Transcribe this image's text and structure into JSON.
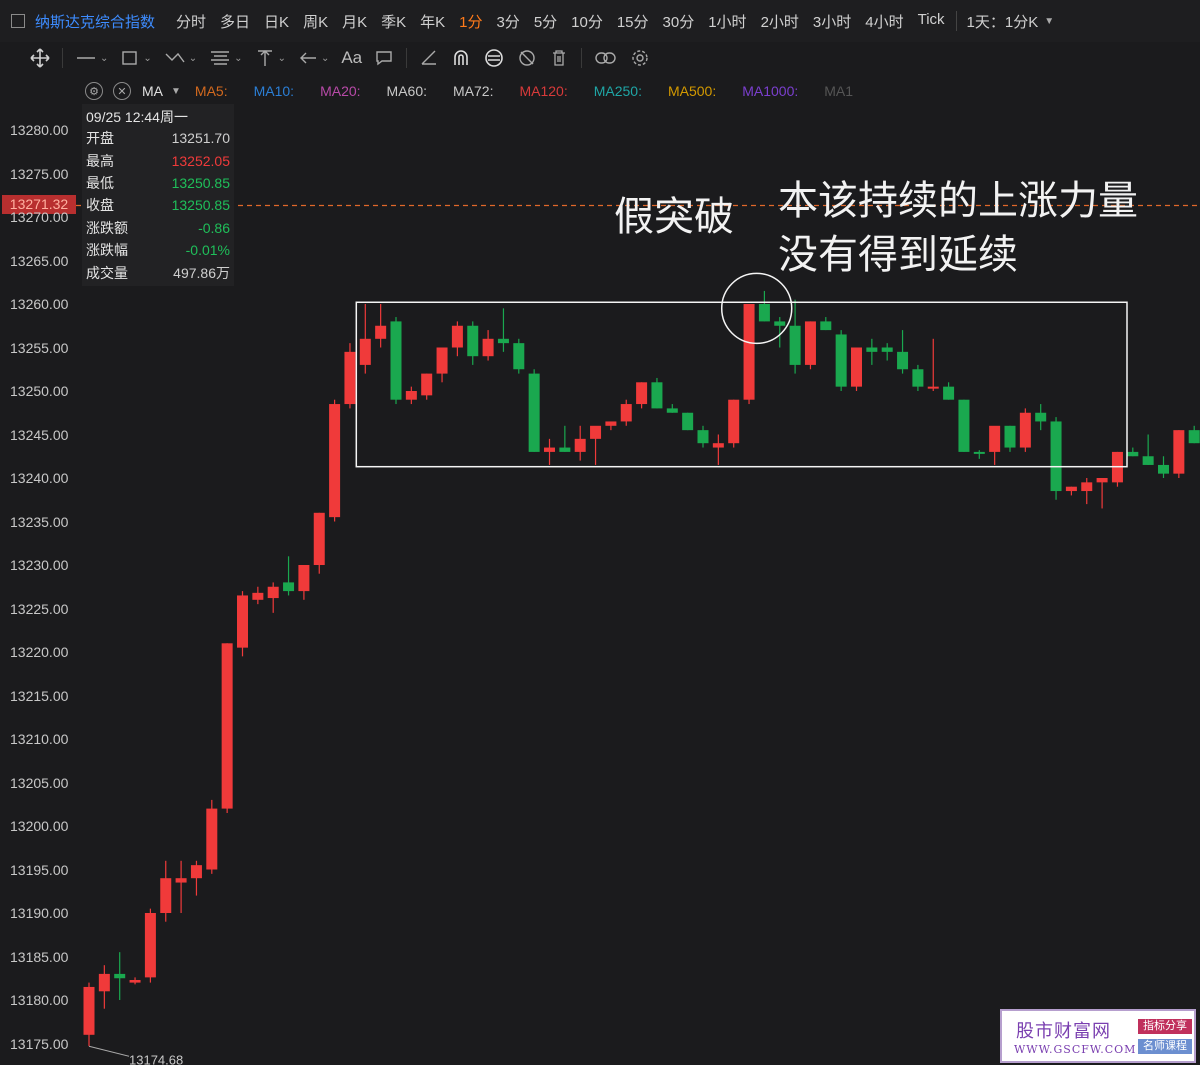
{
  "topbar": {
    "instrument": "纳斯达克综合指数",
    "timeframes": [
      "分时",
      "多日",
      "日K",
      "周K",
      "月K",
      "季K",
      "年K",
      "1分",
      "3分",
      "5分",
      "10分",
      "15分",
      "30分",
      "1小时",
      "2小时",
      "3小时",
      "4小时",
      "Tick"
    ],
    "active_timeframe": "1分",
    "range_label": "1天：1分K"
  },
  "toolbar": {
    "icons": [
      "crosshair-icon",
      "line-icon",
      "rectangle-icon",
      "polyline-icon",
      "fib-icon",
      "vertical-line-icon",
      "arrow-icon",
      "text-icon",
      "comment-icon",
      "ruler-icon",
      "magnet-icon",
      "sync-icon",
      "hide-icon",
      "delete-icon",
      "link-icon",
      "settings-icon"
    ]
  },
  "ma_row": {
    "label": "MA",
    "items": [
      {
        "text": "MA5:",
        "color": "#d2691e"
      },
      {
        "text": "MA10:",
        "color": "#2b7fd6"
      },
      {
        "text": "MA20:",
        "color": "#b84aa8"
      },
      {
        "text": "MA60:",
        "color": "#c8c8c8"
      },
      {
        "text": "MA72:",
        "color": "#c8c8c8"
      },
      {
        "text": "MA120:",
        "color": "#d83a3a"
      },
      {
        "text": "MA250:",
        "color": "#1fa6a6"
      },
      {
        "text": "MA500:",
        "color": "#d49a00"
      },
      {
        "text": "MA1000:",
        "color": "#7b3fcf"
      },
      {
        "text": "MA1",
        "color": "#555555"
      }
    ]
  },
  "info_panel": {
    "datetime": "09/25 12:44周一",
    "rows": [
      {
        "key": "开盘",
        "value": "13251.70",
        "color": "#cfcfcf"
      },
      {
        "key": "最高",
        "value": "13252.05",
        "color": "#f03a3a"
      },
      {
        "key": "最低",
        "value": "13250.85",
        "color": "#1fbf5a"
      },
      {
        "key": "收盘",
        "value": "13250.85",
        "color": "#1fbf5a"
      },
      {
        "key": "涨跌额",
        "value": "-0.86",
        "color": "#1fbf5a"
      },
      {
        "key": "涨跌幅",
        "value": "-0.01%",
        "color": "#1fbf5a"
      },
      {
        "key": "成交量",
        "value": "497.86万",
        "color": "#cfcfcf"
      }
    ]
  },
  "current_price": {
    "value": "13271.32",
    "level": 13271.32
  },
  "annotations": {
    "fake_breakout": "假突破",
    "comment_line1": "本该持续的上涨力量",
    "comment_line2": "没有得到延续"
  },
  "watermark": {
    "name": "股市财富网",
    "url": "WWW.GSCFW.COM",
    "badge1": "指标分享",
    "badge2": "名师课程"
  },
  "chart_data": {
    "type": "candlestick",
    "y_ticks": [
      "13280.00",
      "13275.00",
      "13270.00",
      "13265.00",
      "13260.00",
      "13255.00",
      "13250.00",
      "13245.00",
      "13240.00",
      "13235.00",
      "13230.00",
      "13225.00",
      "13220.00",
      "13215.00",
      "13210.00",
      "13205.00",
      "13200.00",
      "13195.00",
      "13190.00",
      "13185.00",
      "13180.00",
      "13175.00"
    ],
    "ylim": [
      13175,
      13280
    ],
    "low_marker": "13174.68",
    "consolidation_box": {
      "price_high": 13260.2,
      "price_low": 13241.3
    },
    "breakout_circle": {
      "price": 13259.5
    },
    "candles": [
      {
        "o": 13176,
        "h": 13182,
        "l": 13174.7,
        "c": 13181.5
      },
      {
        "o": 13181,
        "h": 13184,
        "l": 13179,
        "c": 13183
      },
      {
        "o": 13183,
        "h": 13185.5,
        "l": 13180,
        "c": 13182.5
      },
      {
        "o": 13182,
        "h": 13182.6,
        "l": 13181.8,
        "c": 13182.3
      },
      {
        "o": 13182.6,
        "h": 13190.5,
        "l": 13182,
        "c": 13190
      },
      {
        "o": 13190,
        "h": 13196,
        "l": 13189,
        "c": 13194
      },
      {
        "o": 13193.5,
        "h": 13196,
        "l": 13190,
        "c": 13194
      },
      {
        "o": 13194,
        "h": 13196,
        "l": 13192,
        "c": 13195.5
      },
      {
        "o": 13195,
        "h": 13203,
        "l": 13194.5,
        "c": 13202
      },
      {
        "o": 13202,
        "h": 13221,
        "l": 13201.5,
        "c": 13221
      },
      {
        "o": 13220.5,
        "h": 13227,
        "l": 13219.5,
        "c": 13226.5
      },
      {
        "o": 13226,
        "h": 13227.5,
        "l": 13225.5,
        "c": 13226.8
      },
      {
        "o": 13226.2,
        "h": 13228,
        "l": 13224.5,
        "c": 13227.5
      },
      {
        "o": 13228,
        "h": 13231,
        "l": 13226.5,
        "c": 13227
      },
      {
        "o": 13227,
        "h": 13229,
        "l": 13226,
        "c": 13230
      },
      {
        "o": 13230,
        "h": 13236,
        "l": 13229,
        "c": 13236
      },
      {
        "o": 13235.5,
        "h": 13249,
        "l": 13235,
        "c": 13248.5
      },
      {
        "o": 13248.5,
        "h": 13255.5,
        "l": 13248,
        "c": 13254.5
      },
      {
        "o": 13253,
        "h": 13260,
        "l": 13252,
        "c": 13256
      },
      {
        "o": 13256,
        "h": 13260,
        "l": 13255,
        "c": 13257.5
      },
      {
        "o": 13258,
        "h": 13258.5,
        "l": 13248.5,
        "c": 13249
      },
      {
        "o": 13249,
        "h": 13250.5,
        "l": 13248.5,
        "c": 13250
      },
      {
        "o": 13249.5,
        "h": 13252,
        "l": 13249,
        "c": 13252
      },
      {
        "o": 13252,
        "h": 13255,
        "l": 13251,
        "c": 13255
      },
      {
        "o": 13255,
        "h": 13258,
        "l": 13254,
        "c": 13257.5
      },
      {
        "o": 13257.5,
        "h": 13258,
        "l": 13253,
        "c": 13254
      },
      {
        "o": 13254,
        "h": 13257,
        "l": 13253.5,
        "c": 13256
      },
      {
        "o": 13256,
        "h": 13259.5,
        "l": 13254.5,
        "c": 13255.5
      },
      {
        "o": 13255.5,
        "h": 13256,
        "l": 13252,
        "c": 13252.5
      },
      {
        "o": 13252,
        "h": 13252.5,
        "l": 13243,
        "c": 13243
      },
      {
        "o": 13243,
        "h": 13244.5,
        "l": 13241.5,
        "c": 13243.5
      },
      {
        "o": 13243.5,
        "h": 13246,
        "l": 13243,
        "c": 13243
      },
      {
        "o": 13243,
        "h": 13246,
        "l": 13242,
        "c": 13244.5
      },
      {
        "o": 13244.5,
        "h": 13245,
        "l": 13241.5,
        "c": 13246
      },
      {
        "o": 13246,
        "h": 13246.3,
        "l": 13245.5,
        "c": 13246.5
      },
      {
        "o": 13246.5,
        "h": 13249,
        "l": 13246,
        "c": 13248.5
      },
      {
        "o": 13248.5,
        "h": 13251,
        "l": 13248,
        "c": 13251
      },
      {
        "o": 13251,
        "h": 13251.5,
        "l": 13248,
        "c": 13248
      },
      {
        "o": 13248,
        "h": 13248.5,
        "l": 13247.5,
        "c": 13247.5
      },
      {
        "o": 13247.5,
        "h": 13247.5,
        "l": 13245.5,
        "c": 13245.5
      },
      {
        "o": 13245.5,
        "h": 13246,
        "l": 13243.5,
        "c": 13244
      },
      {
        "o": 13243.5,
        "h": 13245,
        "l": 13241.5,
        "c": 13244
      },
      {
        "o": 13244,
        "h": 13249,
        "l": 13243.5,
        "c": 13249
      },
      {
        "o": 13249,
        "h": 13260,
        "l": 13248.5,
        "c": 13260
      },
      {
        "o": 13260,
        "h": 13261.5,
        "l": 13258,
        "c": 13258
      },
      {
        "o": 13258,
        "h": 13258.5,
        "l": 13255,
        "c": 13257.5
      },
      {
        "o": 13257.5,
        "h": 13260.5,
        "l": 13252,
        "c": 13253
      },
      {
        "o": 13253,
        "h": 13258,
        "l": 13252.5,
        "c": 13258
      },
      {
        "o": 13258,
        "h": 13258.5,
        "l": 13257,
        "c": 13257
      },
      {
        "o": 13256.5,
        "h": 13257,
        "l": 13250,
        "c": 13250.5
      },
      {
        "o": 13250.5,
        "h": 13255,
        "l": 13250,
        "c": 13255
      },
      {
        "o": 13255,
        "h": 13256,
        "l": 13253,
        "c": 13254.5
      },
      {
        "o": 13255,
        "h": 13255.5,
        "l": 13253.5,
        "c": 13254.5
      },
      {
        "o": 13254.5,
        "h": 13257,
        "l": 13252,
        "c": 13252.5
      },
      {
        "o": 13252.5,
        "h": 13253,
        "l": 13250,
        "c": 13250.5
      },
      {
        "o": 13250.5,
        "h": 13256,
        "l": 13250,
        "c": 13250.5
      },
      {
        "o": 13250.5,
        "h": 13251,
        "l": 13249,
        "c": 13249
      },
      {
        "o": 13249,
        "h": 13249,
        "l": 13243,
        "c": 13243
      },
      {
        "o": 13243,
        "h": 13243.2,
        "l": 13242.2,
        "c": 13242.8
      },
      {
        "o": 13243,
        "h": 13245.5,
        "l": 13241.5,
        "c": 13246
      },
      {
        "o": 13246,
        "h": 13246,
        "l": 13243,
        "c": 13243.5
      },
      {
        "o": 13243.5,
        "h": 13248,
        "l": 13243,
        "c": 13247.5
      },
      {
        "o": 13247.5,
        "h": 13248.5,
        "l": 13245.5,
        "c": 13246.5
      },
      {
        "o": 13246.5,
        "h": 13247,
        "l": 13237.5,
        "c": 13238.5
      },
      {
        "o": 13238.5,
        "h": 13239,
        "l": 13238,
        "c": 13239
      },
      {
        "o": 13238.5,
        "h": 13240,
        "l": 13237,
        "c": 13239.5
      },
      {
        "o": 13239.5,
        "h": 13240,
        "l": 13236.5,
        "c": 13240
      },
      {
        "o": 13239.5,
        "h": 13243,
        "l": 13239,
        "c": 13243
      },
      {
        "o": 13243,
        "h": 13243.5,
        "l": 13242.5,
        "c": 13242.5
      },
      {
        "o": 13242.5,
        "h": 13245,
        "l": 13241.5,
        "c": 13241.5
      },
      {
        "o": 13241.5,
        "h": 13242.5,
        "l": 13240,
        "c": 13240.5
      },
      {
        "o": 13240.5,
        "h": 13245.5,
        "l": 13240,
        "c": 13245.5
      },
      {
        "o": 13245.5,
        "h": 13246,
        "l": 13244,
        "c": 13244
      }
    ]
  }
}
